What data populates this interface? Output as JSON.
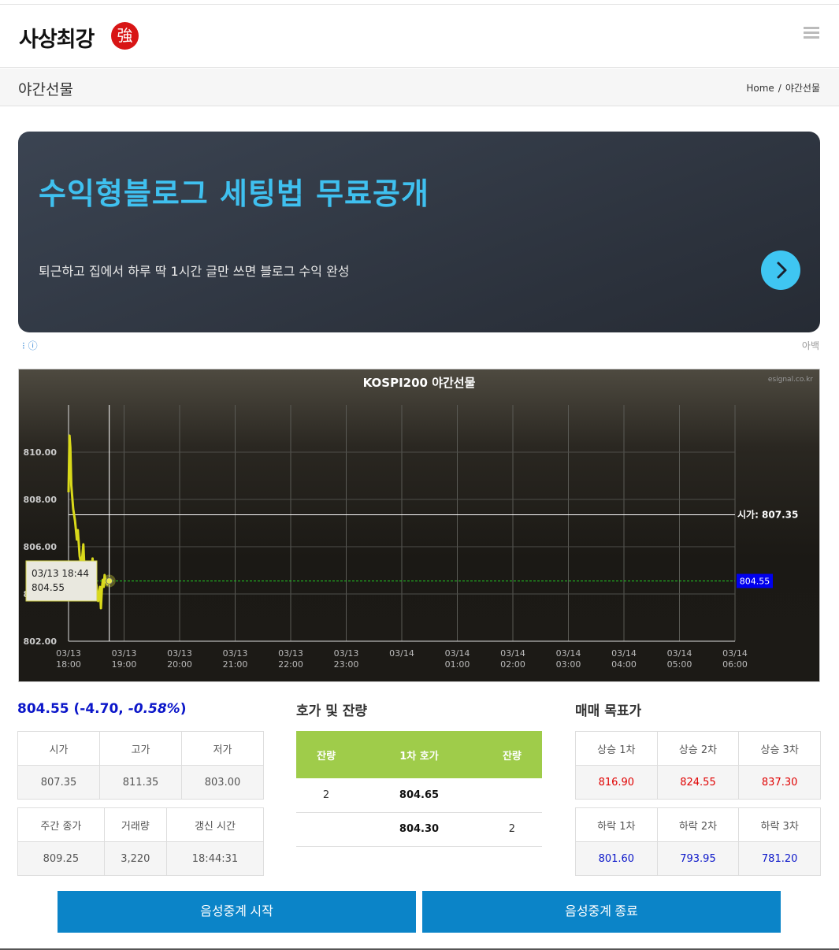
{
  "header": {
    "logo_text": "사상최강",
    "logo_seal": "強"
  },
  "title_bar": {
    "title": "야간선물",
    "breadcrumb_home": "Home",
    "breadcrumb_sep": "/",
    "breadcrumb_current": "야간선물"
  },
  "ad": {
    "headline": "수익형블로그 세팅법 무료공개",
    "subtext": "퇴근하고 집에서 하루 딱 1시간 글만 쓰면 블로그 수익 완성",
    "label": "아백",
    "meta_icons": "⁝ ⓘ"
  },
  "chart_data": {
    "type": "line",
    "title": "KOSPI200 야간선물",
    "watermark": "esignal.co.kr",
    "ylim": [
      802,
      812
    ],
    "yticks": [
      "810.00",
      "808.00",
      "806.00",
      "804.00",
      "802.00"
    ],
    "xticks": [
      [
        "03/13",
        "18:00"
      ],
      [
        "03/13",
        "19:00"
      ],
      [
        "03/13",
        "20:00"
      ],
      [
        "03/13",
        "21:00"
      ],
      [
        "03/13",
        "22:00"
      ],
      [
        "03/13",
        "23:00"
      ],
      [
        "03/14",
        ""
      ],
      [
        "03/14",
        "01:00"
      ],
      [
        "03/14",
        "02:00"
      ],
      [
        "03/14",
        "03:00"
      ],
      [
        "03/14",
        "04:00"
      ],
      [
        "03/14",
        "05:00"
      ],
      [
        "03/14",
        "06:00"
      ]
    ],
    "series": [
      {
        "color": "#d9d91a",
        "x_minutes": [
          0,
          1,
          2,
          3,
          5,
          7,
          9,
          10,
          12,
          14,
          16,
          18,
          20,
          22,
          24,
          26,
          28,
          29,
          30,
          31,
          32,
          33,
          34,
          35,
          36,
          37,
          38,
          39,
          40,
          41,
          42,
          43,
          44
        ],
        "values": [
          808.3,
          810.7,
          810.2,
          808.6,
          807.6,
          807.1,
          806.3,
          806.7,
          805.6,
          805.2,
          806.1,
          804.3,
          804.8,
          803.9,
          804.2,
          805.5,
          804.1,
          803.8,
          804.4,
          803.9,
          803.7,
          804.1,
          804.3,
          803.4,
          804.2,
          804.6,
          804.3,
          804.8,
          804.5,
          804.6,
          804.4,
          804.5,
          804.55
        ]
      }
    ],
    "open_line": {
      "label": "시가:",
      "value": "807.35",
      "y": 807.35
    },
    "current": {
      "value": "804.55",
      "y": 804.55
    },
    "tooltip": {
      "time": "03/13 18:44",
      "value": "804.55"
    },
    "cursor_minutes": 44,
    "grid": true,
    "colors": {
      "open_line": "#ffffff",
      "current_line": "#22cc22",
      "current_badge": "#0000ee"
    }
  },
  "price_summary": {
    "price": "804.55",
    "change": "(-4.70, ",
    "pct": "-0.58%",
    "close": ")"
  },
  "stats1": {
    "headers": [
      "시가",
      "고가",
      "저가"
    ],
    "values": [
      "807.35",
      "811.35",
      "803.00"
    ]
  },
  "stats2": {
    "headers": [
      "주간 종가",
      "거래량",
      "갱신 시간"
    ],
    "values": [
      "809.25",
      "3,220",
      "18:44:31"
    ]
  },
  "orderbook": {
    "title": "호가 및 잔량",
    "headers": [
      "잔량",
      "1차 호가",
      "잔량"
    ],
    "rows": [
      [
        "2",
        "804.65",
        ""
      ],
      [
        "",
        "804.30",
        "2"
      ]
    ]
  },
  "targets": {
    "title": "매매 목표가",
    "up_headers": [
      "상승 1차",
      "상승 2차",
      "상승 3차"
    ],
    "up_values": [
      "816.90",
      "824.55",
      "837.30"
    ],
    "down_headers": [
      "하락 1차",
      "하락 2차",
      "하락 3차"
    ],
    "down_values": [
      "801.60",
      "793.95",
      "781.20"
    ]
  },
  "buttons": {
    "start": "음성중계 시작",
    "stop": "음성중계 종료"
  }
}
